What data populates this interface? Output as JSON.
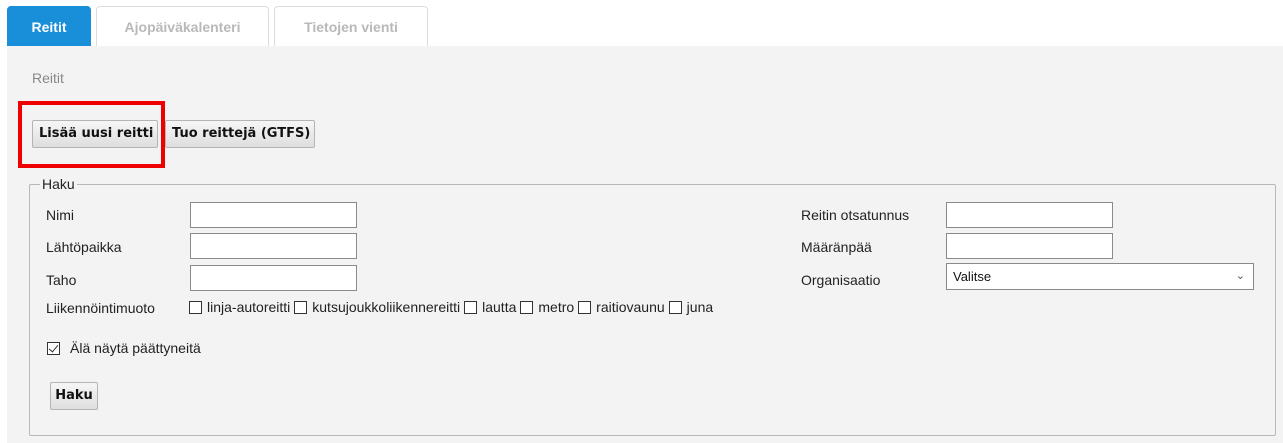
{
  "tabs": [
    {
      "label": "Reitit",
      "active": true
    },
    {
      "label": "Ajopäiväkalenteri",
      "active": false
    },
    {
      "label": "Tietojen vienti",
      "active": false
    }
  ],
  "breadcrumb": "Reitit",
  "actions": {
    "add_route": "Lisää uusi reitti",
    "import_gtfs": "Tuo reittejä (GTFS)"
  },
  "search": {
    "legend": "Haku",
    "fields": {
      "name": {
        "label": "Nimi",
        "value": ""
      },
      "origin": {
        "label": "Lähtöpaikka",
        "value": ""
      },
      "party": {
        "label": "Taho",
        "value": ""
      },
      "route_header": {
        "label": "Reitin otsatunnus",
        "value": ""
      },
      "destination": {
        "label": "Määränpää",
        "value": ""
      },
      "organisation": {
        "label": "Organisaatio",
        "selected": "Valitse"
      }
    },
    "transport_mode": {
      "label": "Liikennöintimuoto",
      "options": [
        {
          "label": "linja-autoreitti",
          "checked": false
        },
        {
          "label": "kutsujoukkoliikennereitti",
          "checked": false
        },
        {
          "label": "lautta",
          "checked": false
        },
        {
          "label": "metro",
          "checked": false
        },
        {
          "label": "raitiovaunu",
          "checked": false
        },
        {
          "label": "juna",
          "checked": false
        }
      ]
    },
    "hide_ended": {
      "label": "Älä näytä päättyneitä",
      "checked": true
    },
    "submit": "Haku"
  },
  "colors": {
    "active_tab": "#1a8fd9",
    "panel_bg": "#f3f3f3",
    "highlight": "#ee0000"
  }
}
